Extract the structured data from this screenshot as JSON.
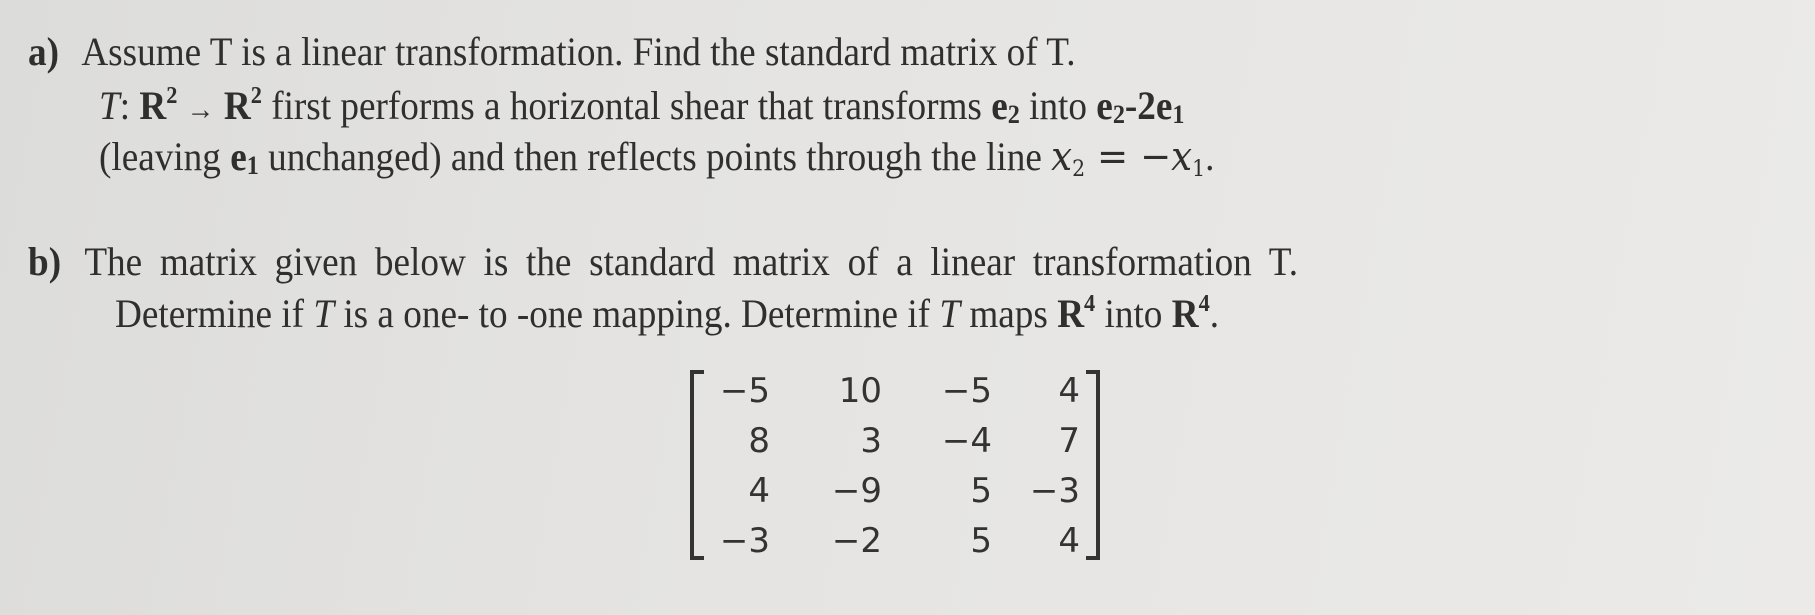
{
  "part_a": {
    "label": "a)",
    "line1": "Assume T is a linear transformation. Find the standard matrix of T.",
    "line2": {
      "map_T": "T",
      "colon": ":",
      "domain_R": "R",
      "domain_exp": "2",
      "arrow": "→",
      "codomain_R": "R",
      "codomain_exp": "2",
      "text1": " first performs a horizontal shear that transforms ",
      "e2_base": "e",
      "e2_sub": "2",
      "text2": " into ",
      "res_e2_base": "e",
      "res_e2_sub": "2",
      "res_mid": "-2",
      "res_e1_base": "e",
      "res_e1_sub": "1"
    },
    "line3": {
      "text1": "(leaving ",
      "e1_base": "e",
      "e1_sub": "1",
      "text2": " unchanged) and then reflects points through the line ",
      "x2_base": "x",
      "x2_sub": "2",
      "equals": " = −",
      "x1_base": "x",
      "x1_sub": "1",
      "end": "."
    }
  },
  "part_b": {
    "label": "b)",
    "line1": "The matrix given below is the standard matrix of a linear transformation T.",
    "line2": {
      "text1": "Determine if ",
      "T": "T",
      "text2": " is a one- to -one mapping. Determine if ",
      "T2": "T",
      "text3": " maps ",
      "R1": "R",
      "R1_exp": "4",
      "text4": " into ",
      "R2": "R",
      "R2_exp": "4",
      "end": "."
    },
    "matrix": [
      [
        "−5",
        "10",
        "−5",
        "4"
      ],
      [
        "8",
        "3",
        "−4",
        "7"
      ],
      [
        "4",
        "−9",
        "5",
        "−3"
      ],
      [
        "−3",
        "−2",
        "5",
        "4"
      ]
    ]
  }
}
